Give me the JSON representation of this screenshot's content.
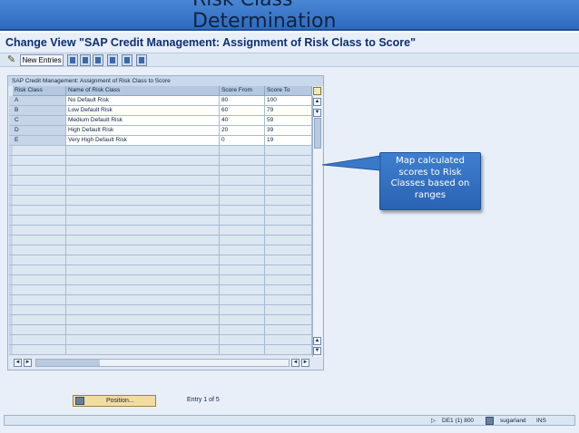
{
  "slide": {
    "title_line1": "Risk Class",
    "title_line2": "Determination"
  },
  "window": {
    "title": "Change View \"SAP Credit Management: Assignment of Risk Class to Score\""
  },
  "toolbar": {
    "new_entries": "New Entries"
  },
  "table": {
    "title": "SAP Credit Management: Assignment of Risk Class to Score",
    "columns": [
      "Risk Class",
      "Name of Risk Class",
      "Score From",
      "Score To"
    ],
    "rows": [
      [
        "A",
        "No Default Risk",
        "80",
        "100"
      ],
      [
        "B",
        "Low Default Risk",
        "60",
        "79"
      ],
      [
        "C",
        "Medium Default Risk",
        "40",
        "59"
      ],
      [
        "D",
        "High Default Risk",
        "20",
        "39"
      ],
      [
        "E",
        "Very High Default Risk",
        "0",
        "19"
      ]
    ]
  },
  "callout": {
    "text": "Map calculated scores to Risk Classes based on ranges"
  },
  "footer": {
    "position_label": "Position...",
    "entry_info": "Entry 1 of 5"
  },
  "status": {
    "system": "DE1 (1) 800",
    "user": "sugarland",
    "mode": "INS"
  },
  "colors": {
    "banner": "#2e6bc0",
    "callout": "#2a63b2",
    "title_text": "#0e2f73"
  }
}
